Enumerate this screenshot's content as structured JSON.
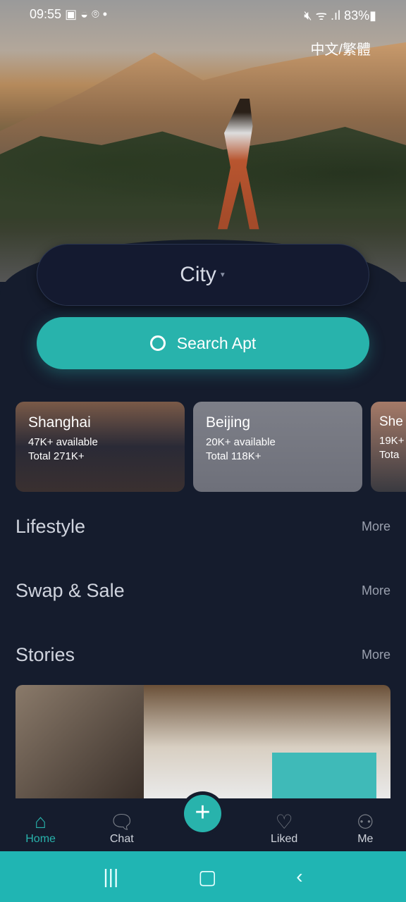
{
  "status": {
    "time": "09:55",
    "battery": "83%"
  },
  "header": {
    "language": "中文/繁體"
  },
  "search": {
    "city_placeholder": "City",
    "button_label": "Search Apt"
  },
  "cities": [
    {
      "name": "Shanghai",
      "available": "47K+ available",
      "total": "Total 271K+"
    },
    {
      "name": "Beijing",
      "available": "20K+ available",
      "total": "Total 118K+"
    },
    {
      "name": "She",
      "available": "19K+",
      "total": "Tota"
    }
  ],
  "sections": [
    {
      "title": "Lifestyle",
      "more": "More"
    },
    {
      "title": "Swap & Sale",
      "more": "More"
    },
    {
      "title": "Stories",
      "more": "More"
    }
  ],
  "nav": {
    "home": "Home",
    "chat": "Chat",
    "add": "+",
    "liked": "Liked",
    "me": "Me"
  },
  "colors": {
    "accent": "#28b3ac",
    "background": "#151c2d"
  }
}
